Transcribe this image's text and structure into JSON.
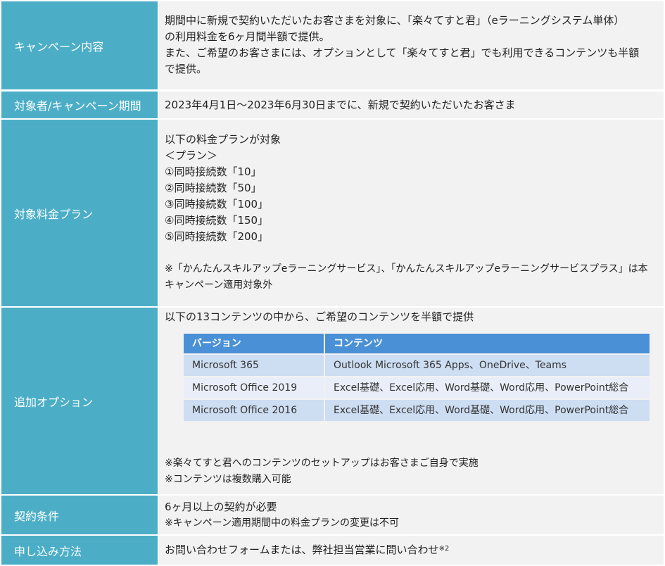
{
  "rows": {
    "campaign": {
      "header": "キャンペーン内容",
      "lines": [
        "期間中に新規で契約いただいたお客さまを対象に、「楽々てすと君」（eラーニングシステム単体）",
        "の利用料金を6ヶ月間半額で提供。",
        "また、ご希望のお客さまには、オプションとして「楽々てすと君」でも利用できるコンテンツも半額",
        "で提供。"
      ]
    },
    "period": {
      "header": "対象者/キャンペーン期間",
      "text": "2023年4月1日～2023年6月30日までに、新規で契約いただいたお客さま"
    },
    "plans": {
      "header": "対象料金プラン",
      "intro": "以下の料金プランが対象",
      "plan_heading": "＜プラン＞",
      "items": [
        "①同時接続数「10」",
        "②同時接続数「50」",
        "③同時接続数「100」",
        "④同時接続数「150」",
        "⑤同時接続数「200」"
      ],
      "note_lines": [
        "※「かんたんスキルアップeラーニングサービス」、「かんたんスキルアップeラーニングサービスプラス」は本",
        "キャンペーン適用対象外"
      ]
    },
    "options": {
      "header": "追加オプション",
      "intro": "以下の13コンテンツの中から、ご希望のコンテンツを半額で提供",
      "table": {
        "columns": [
          "バージョン",
          "コンテンツ"
        ],
        "rows": [
          [
            "Microsoft 365",
            "Outlook Microsoft 365 Apps、OneDrive、Teams"
          ],
          [
            "Microsoft Office 2019",
            "Excel基礎、Excel応用、Word基礎、Word応用、PowerPoint総合"
          ],
          [
            "Microsoft Office 2016",
            "Excel基礎、Excel応用、Word基礎、Word応用、PowerPoint総合"
          ]
        ]
      },
      "notes": [
        "※楽々てすと君へのコンテンツのセットアップはお客さまご自身で実施",
        "※コンテンツは複数購入可能"
      ]
    },
    "terms": {
      "header": "契約条件",
      "lines": [
        "6ヶ月以上の契約が必要",
        "※キャンペーン適用期間中の料金プランの変更は不可"
      ]
    },
    "apply": {
      "header": "申し込み方法",
      "text": "お問い合わせフォームまたは、弊社担当営業に問い合わせ",
      "sup": "※2"
    }
  }
}
